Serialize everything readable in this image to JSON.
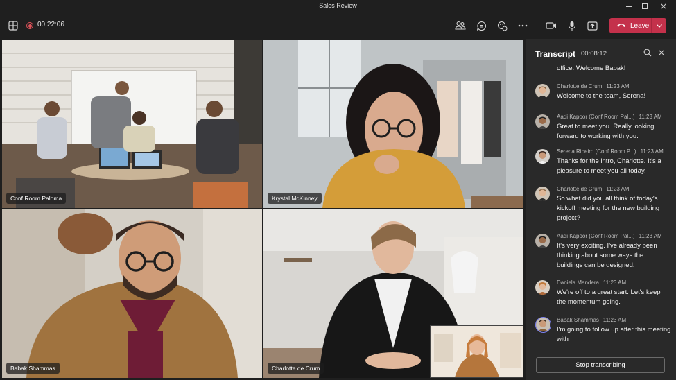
{
  "window": {
    "title": "Sales Review"
  },
  "toolbar": {
    "recording_time": "00:22:06",
    "leave_label": "Leave",
    "icons": [
      "grid-icon",
      "record-icon",
      "people-icon",
      "chat-icon",
      "react-icon",
      "more-icon",
      "camera-icon",
      "mic-icon",
      "share-icon",
      "phone-icon",
      "chevron-down-icon"
    ]
  },
  "participants": [
    {
      "name": "Conf Room Paloma"
    },
    {
      "name": "Krystal McKinney"
    },
    {
      "name": "Babak Shammas"
    },
    {
      "name": "Charlotte de Crum"
    }
  ],
  "transcript": {
    "title": "Transcript",
    "elapsed": "00:08:12",
    "partial_text": "office. Welcome Babak!",
    "entries": [
      {
        "speaker": "Charlotte de Crum",
        "time": "11:23 AM",
        "text": "Welcome to the team, Serena!"
      },
      {
        "speaker": "Aadi Kapoor (Conf Room Pal...)",
        "time": "11:23 AM",
        "text": "Great to meet you. Really looking forward to working with you."
      },
      {
        "speaker": "Serena Ribeiro (Conf Room P...)",
        "time": "11:23 AM",
        "text": "Thanks for the intro, Charlotte. It's a pleasure to meet you all today."
      },
      {
        "speaker": "Charlotte de Crum",
        "time": "11:23 AM",
        "text": "So what did you all think of today's kickoff meeting for the new building project?"
      },
      {
        "speaker": "Aadi Kapoor (Conf Room Pal...)",
        "time": "11:23 AM",
        "text": "It's very exciting. I've already been thinking about some ways the buildings can be designed."
      },
      {
        "speaker": "Daniela Mandera",
        "time": "11:23 AM",
        "text": "We're off to a great start. Let's keep the momentum going."
      },
      {
        "speaker": "Babak Shammas",
        "time": "11:23 AM",
        "text": "I'm going to follow up after this meeting with"
      }
    ],
    "stop_label": "Stop transcribing"
  },
  "colors": {
    "leave": "#c4314b",
    "record": "#e0535a",
    "panel": "#292929",
    "background": "#1f1f1f"
  }
}
